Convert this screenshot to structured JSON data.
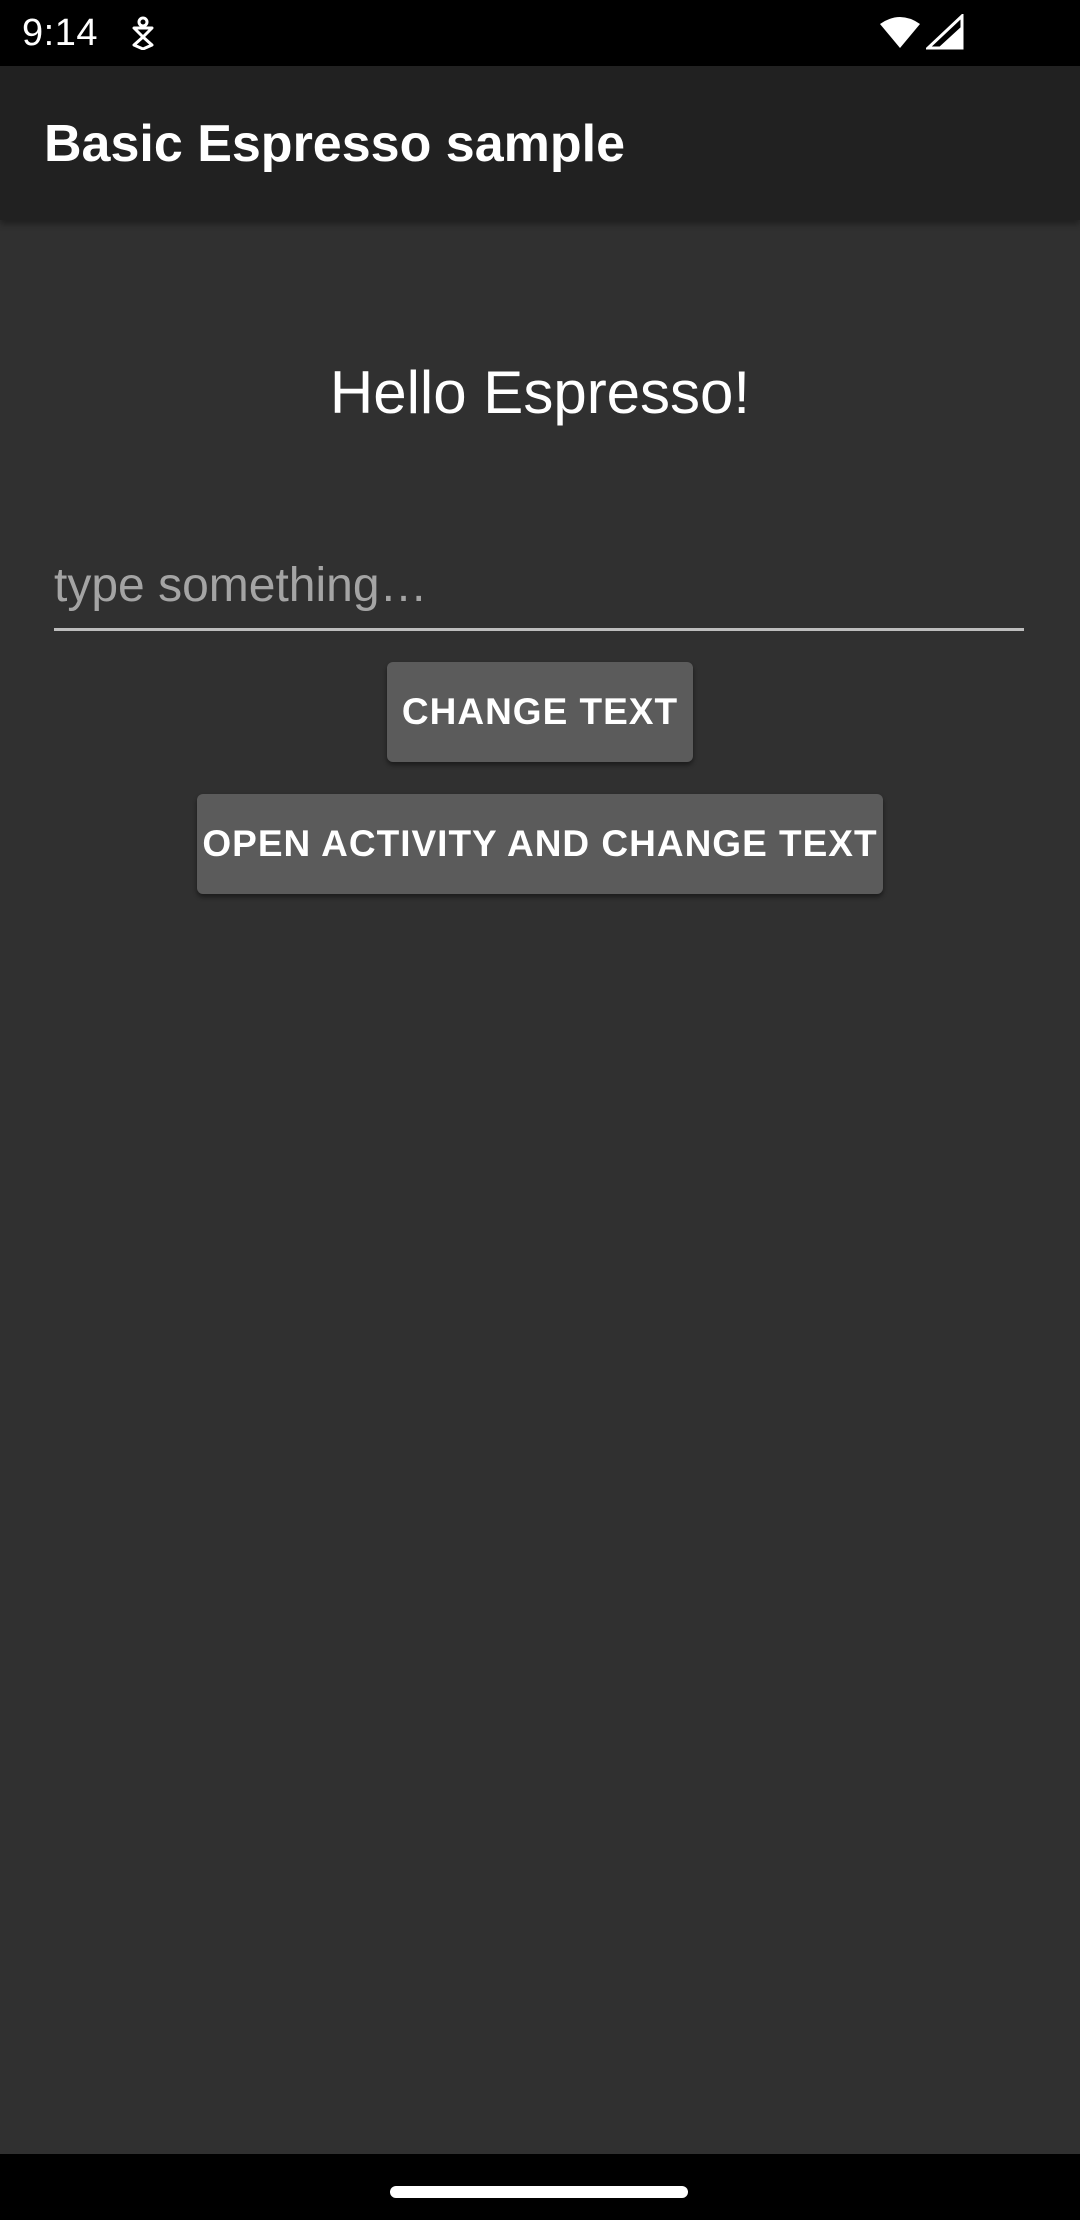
{
  "status_bar": {
    "time": "9:14",
    "icons": [
      "notification-icon",
      "wifi-icon",
      "cellular-signal-icon"
    ]
  },
  "app_bar": {
    "title": "Basic Espresso sample",
    "background": "#212121"
  },
  "main": {
    "hello_text": "Hello Espresso!",
    "input": {
      "value": "",
      "placeholder": "type something…"
    },
    "buttons": {
      "change_text": "CHANGE TEXT",
      "open_activity": "OPEN ACTIVITY AND CHANGE TEXT"
    },
    "background": "#303030",
    "button_color": "#5b5b5b"
  },
  "nav_bar": {
    "handle": "home-gesture-handle"
  }
}
